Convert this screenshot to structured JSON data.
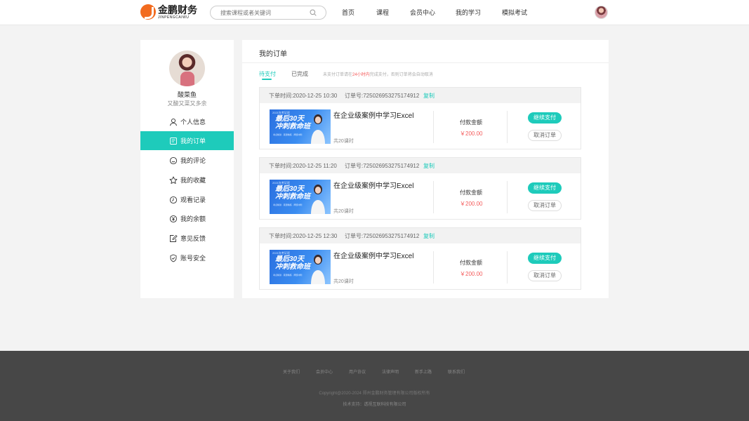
{
  "header": {
    "logo_cn": "金鹏财务",
    "logo_en": "JINPENGCAIWU",
    "search_placeholder": "搜索课程或者关键词",
    "nav": [
      "首页",
      "课程",
      "会员中心",
      "我的学习",
      "模拟考试"
    ]
  },
  "profile": {
    "name": "酸菜鱼",
    "subtitle": "又酸又菜又多余"
  },
  "sidebar": {
    "items": [
      {
        "label": "个人信息",
        "icon": "user-icon",
        "active": false
      },
      {
        "label": "我的订单",
        "icon": "order-icon",
        "active": true
      },
      {
        "label": "我的评论",
        "icon": "comment-icon",
        "active": false
      },
      {
        "label": "我的收藏",
        "icon": "star-icon",
        "active": false
      },
      {
        "label": "观看记录",
        "icon": "clock-icon",
        "active": false
      },
      {
        "label": "我的余额",
        "icon": "yen-icon",
        "active": false
      },
      {
        "label": "意见反馈",
        "icon": "feedback-icon",
        "active": false
      },
      {
        "label": "账号安全",
        "icon": "shield-icon",
        "active": false
      }
    ]
  },
  "main": {
    "title": "我的订单",
    "tabs": {
      "pending": "待支付",
      "done": "已完成"
    },
    "notice": {
      "pre": "未支付订单请在",
      "highlight": "24小时内",
      "post": "完成支付，否则订单将会自动取消"
    }
  },
  "orders": [
    {
      "time_label": "下单时间:2020-12-25  10:30",
      "order_no_label": "订单号:725026953275174912",
      "copy": "复制",
      "course_title": "在企业级案例中学习Excel",
      "lessons": "共20课时",
      "pay_label": "付款金额",
      "amount": "￥200.00",
      "pay_button": "继续支付",
      "cancel_button": "取消订单"
    },
    {
      "time_label": "下单时间:2020-12-25  11:20",
      "order_no_label": "订单号:725026953275174912",
      "copy": "复制",
      "course_title": "在企业级案例中学习Excel",
      "lessons": "共20课时",
      "pay_label": "付款金额",
      "amount": "￥200.00",
      "pay_button": "继续支付",
      "cancel_button": "取消订单"
    },
    {
      "time_label": "下单时间:2020-12-25  12:30",
      "order_no_label": "订单号:725026953275174912",
      "copy": "复制",
      "course_title": "在企业级案例中学习Excel",
      "lessons": "共20课时",
      "pay_label": "付款金额",
      "amount": "￥200.00",
      "pay_button": "继续支付",
      "cancel_button": "取消订单"
    }
  ],
  "thumb": {
    "line1": "2021年考证班",
    "line2": "最后30天",
    "line3": "冲刺救命班",
    "line4": "考点精讲 · 真题精练 · 押题冲刺"
  },
  "footer": {
    "links": [
      "关于我们",
      "会员中心",
      "用户协议",
      "法律声明",
      "新手上路",
      "联系我们"
    ],
    "copyright": "Copyright@2020-2024 郑州金鹏财务管理有限公司版权所有",
    "support": "技术支持：透视互联科技有限公司"
  },
  "colors": {
    "accent": "#1ecbbb",
    "price": "#f45a5a",
    "footer_bg": "#474747"
  }
}
